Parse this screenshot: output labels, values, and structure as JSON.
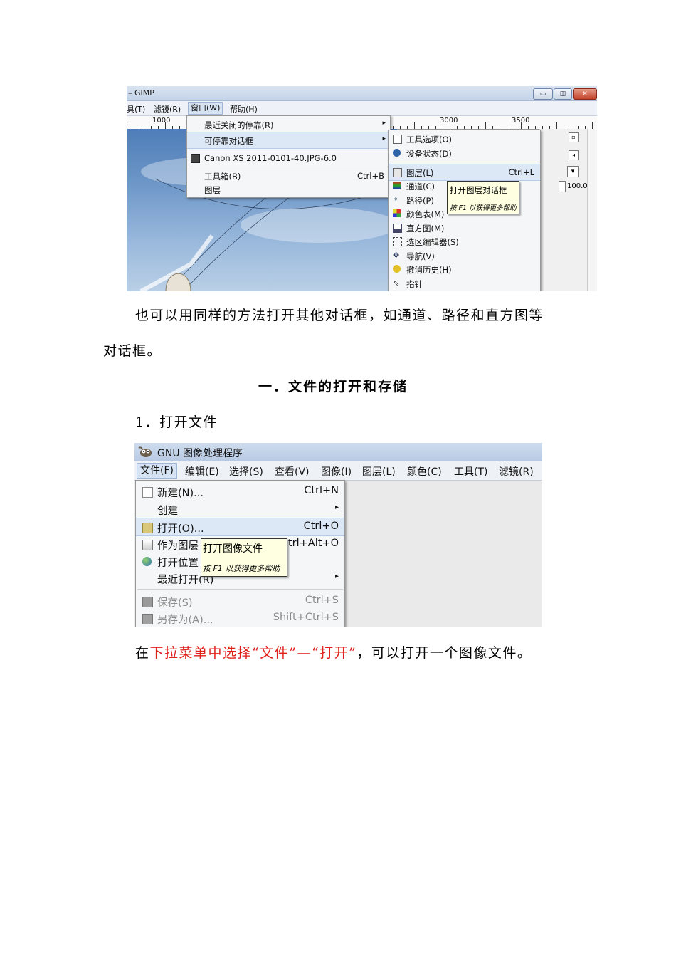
{
  "shot1": {
    "title": "– GIMP",
    "window_buttons": {
      "minimize": "▭",
      "restore": "◫",
      "close": "✕"
    },
    "menubar": [
      "具(T)",
      "滤镜(R)",
      "窗口(W)",
      "帮助(H)"
    ],
    "ruler_labels": [
      "1000",
      "3000",
      "3500"
    ],
    "window_menu": {
      "items": [
        {
          "label": "最近关闭的停靠(R)",
          "shortcut": "",
          "submenu": true
        },
        {
          "label": "可停靠对话框",
          "shortcut": "",
          "submenu": true
        },
        {
          "label": "Canon XS 2011-0101-40.JPG-6.0",
          "shortcut": ""
        },
        {
          "label": "工具箱(B)",
          "shortcut": "Ctrl+B"
        },
        {
          "label": "图层",
          "shortcut": ""
        }
      ]
    },
    "dock_menu": {
      "items": [
        {
          "label": "工具选项(O)",
          "shortcut": ""
        },
        {
          "label": "设备状态(D)",
          "shortcut": ""
        },
        {
          "label": "图层(L)",
          "shortcut": "Ctrl+L"
        },
        {
          "label": "通道(C)",
          "shortcut": ""
        },
        {
          "label": "路径(P)",
          "shortcut": ""
        },
        {
          "label": "颜色表(M)",
          "shortcut": ""
        },
        {
          "label": "直方图(M)",
          "shortcut": ""
        },
        {
          "label": "选区编辑器(S)",
          "shortcut": ""
        },
        {
          "label": "导航(V)",
          "shortcut": ""
        },
        {
          "label": "撤消历史(H)",
          "shortcut": ""
        },
        {
          "label": "指针",
          "shortcut": ""
        }
      ]
    },
    "tooltip": {
      "title": "打开图层对话框",
      "hint": "按 F1 以获得更多帮助"
    },
    "zoom_value": "100.0"
  },
  "paragraph1": {
    "line1": "也可以用同样的方法打开其他对话框，如通道、路径和直方图等",
    "line2": "对话框。"
  },
  "heading": "一．文件的打开和存储",
  "subheading": "1．打开文件",
  "shot2": {
    "title": "GNU 图像处理程序",
    "menubar": [
      "文件(F)",
      "编辑(E)",
      "选择(S)",
      "查看(V)",
      "图像(I)",
      "图层(L)",
      "颜色(C)",
      "工具(T)",
      "滤镜(R)"
    ],
    "file_menu": {
      "items": [
        {
          "label": "新建(N)...",
          "shortcut": "Ctrl+N"
        },
        {
          "label": "创建",
          "shortcut": "",
          "submenu": true
        },
        {
          "label": "打开(O)...",
          "shortcut": "Ctrl+O"
        },
        {
          "label": "作为图层",
          "shortcut": "trl+Alt+O"
        },
        {
          "label": "打开位置",
          "shortcut": ""
        },
        {
          "label": "最近打开(R)",
          "shortcut": "",
          "submenu": true
        },
        {
          "label": "保存(S)",
          "shortcut": "Ctrl+S"
        },
        {
          "label": "另存为(A)...",
          "shortcut": "Shift+Ctrl+S"
        }
      ]
    },
    "tooltip": {
      "title": "打开图像文件",
      "hint": "按 F1 以获得更多帮助"
    }
  },
  "paragraph2": {
    "prefix": "在",
    "red_part": "下拉菜单中选择“文件”—“打开”",
    "suffix": "，可以打开一个图像文件。"
  },
  "colors": {
    "red_text": "#e0201b",
    "menu_highlight": "#dde8f6",
    "tooltip_bg": "#ffffe1"
  }
}
